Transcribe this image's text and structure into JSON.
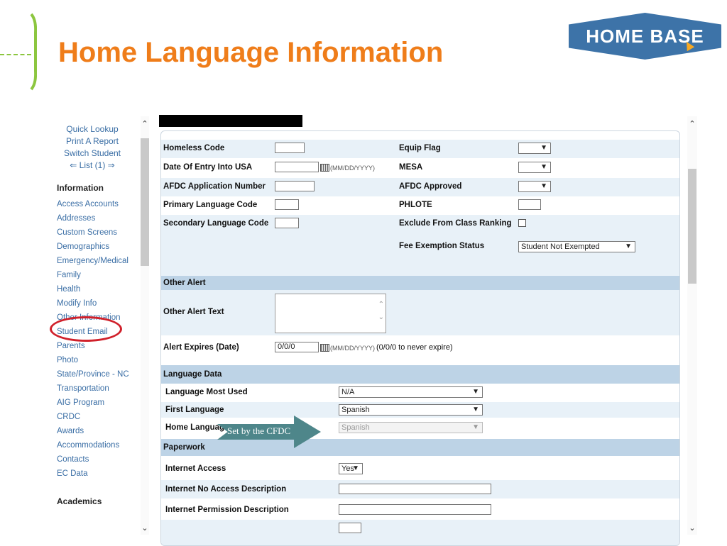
{
  "header": {
    "title": "Home Language Information",
    "logo_text": "HOME BASE",
    "colors": {
      "title": "#ef7d1a",
      "accent_green": "#8cc63f",
      "logo_blue": "#3d73a8"
    }
  },
  "sidebar": {
    "top_links": [
      "Quick Lookup",
      "Print A Report",
      "Switch Student",
      "⇐ List (1) ⇒"
    ],
    "sections": [
      {
        "heading": "Information",
        "items": [
          "Access Accounts",
          "Addresses",
          "Custom Screens",
          "Demographics",
          "Emergency/Medical",
          "Family",
          "Health",
          "Modify Info",
          "Other Information",
          "Student Email",
          "Parents",
          "Photo",
          "State/Province - NC",
          "Transportation",
          "AIG Program",
          "CRDC",
          "Awards",
          "Accommodations",
          "Contacts",
          "EC Data"
        ]
      },
      {
        "heading": "Academics",
        "items": []
      }
    ],
    "highlighted_item": "Other Information"
  },
  "form": {
    "homeless_code": {
      "label": "Homeless Code",
      "value": ""
    },
    "equip_flag": {
      "label": "Equip Flag",
      "value": ""
    },
    "date_entry_usa": {
      "label": "Date Of Entry Into USA",
      "value": "",
      "hint": "(MM/DD/YYYY)"
    },
    "mesa": {
      "label": "MESA",
      "value": ""
    },
    "afdc_app_number": {
      "label": "AFDC Application Number",
      "value": ""
    },
    "afdc_approved": {
      "label": "AFDC Approved",
      "value": ""
    },
    "primary_lang_code": {
      "label": "Primary Language Code",
      "value": ""
    },
    "phlote": {
      "label": "PHLOTE",
      "value": ""
    },
    "secondary_lang_code": {
      "label": "Secondary Language Code",
      "value": ""
    },
    "exclude_class_rank": {
      "label": "Exclude From Class Ranking",
      "checked": false
    },
    "fee_exemption": {
      "label": "Fee Exemption Status",
      "value": "Student Not Exempted"
    },
    "other_alert": {
      "section": "Other Alert",
      "text_label": "Other Alert Text",
      "expires_label": "Alert Expires (Date)",
      "expires_value": "0/0/0",
      "expires_hint": "(MM/DD/YYYY)",
      "expires_note": "(0/0/0 to never expire)"
    },
    "language_data": {
      "section": "Language Data",
      "most_used": {
        "label": "Language Most Used",
        "value": "N/A"
      },
      "first": {
        "label": "First Language",
        "value": "Spanish"
      },
      "home": {
        "label": "Home Language",
        "value": "Spanish"
      }
    },
    "paperwork": {
      "section": "Paperwork",
      "internet_access": {
        "label": "Internet Access",
        "value": "Yes"
      },
      "no_access_desc": {
        "label": "Internet No Access Description",
        "value": ""
      },
      "permission_desc": {
        "label": "Internet Permission Description",
        "value": ""
      }
    }
  },
  "callout": {
    "text": "Set by the CFDC",
    "color": "#4e868a"
  }
}
